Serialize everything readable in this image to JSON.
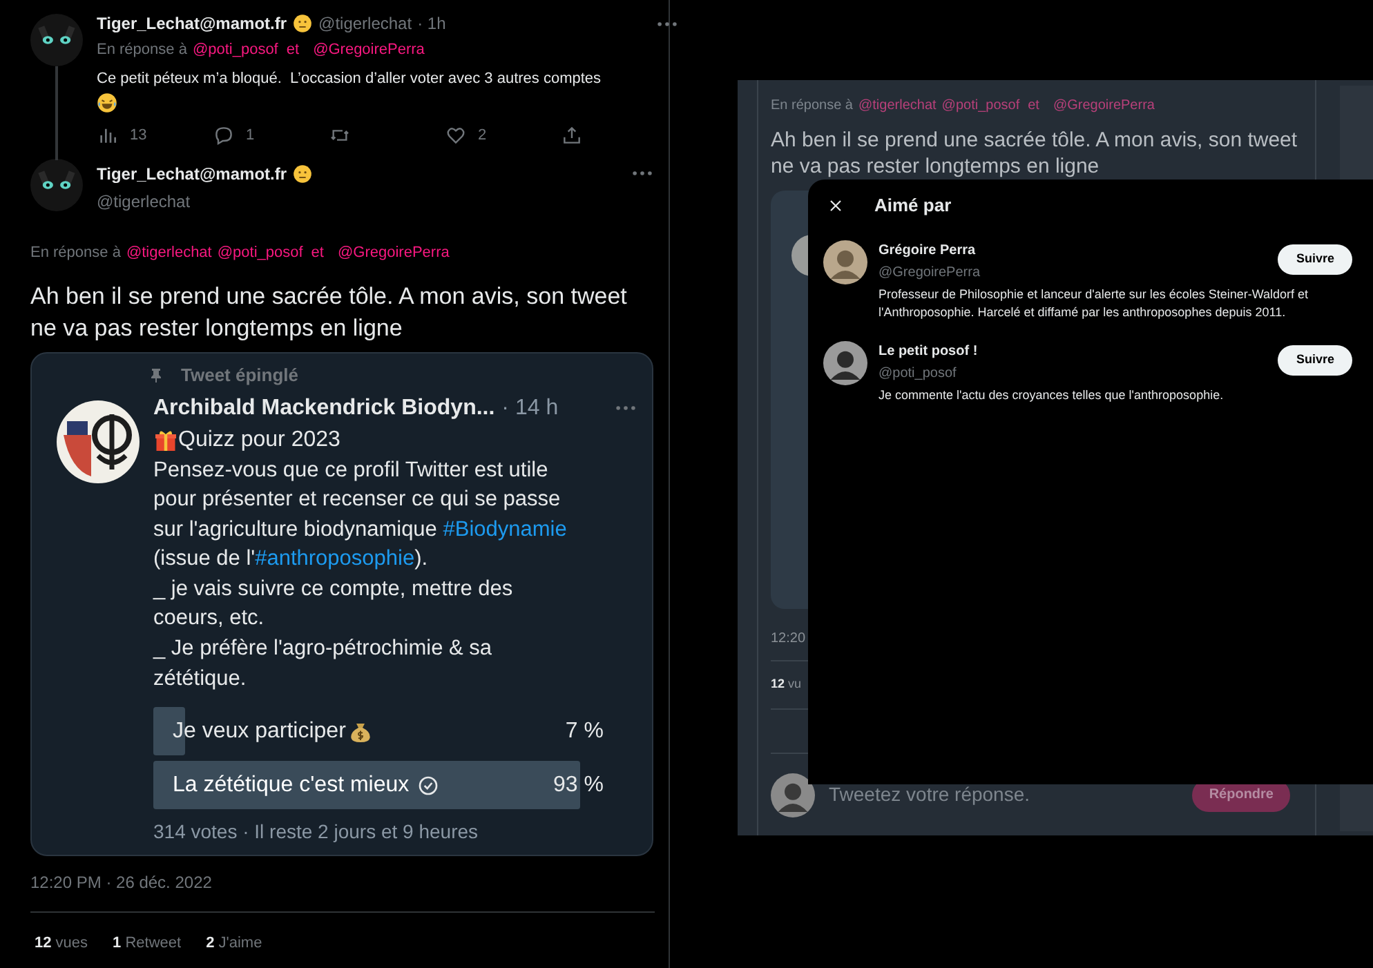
{
  "thread": [
    {
      "author": "Tiger_Lechat@mamot.fr",
      "handle": "@tigerlechat",
      "time": "· 1h",
      "reply_prefix": "En réponse à",
      "mentions": [
        {
          "text": "@poti_posof",
          "kind": "mention"
        },
        {
          "text": "et",
          "kind": "joiner"
        },
        {
          "text": "@GregoirePerra",
          "kind": "mention"
        }
      ],
      "text": "Ce petit péteux m’a bloqué.  L’occasion d’aller voter avec 3 autres comptes",
      "stats": [
        {
          "kind": "views",
          "value": "13"
        },
        {
          "kind": "reply",
          "value": "1"
        },
        {
          "kind": "retweet"
        },
        {
          "kind": "like",
          "value": "2"
        },
        {
          "kind": "share"
        }
      ]
    },
    {
      "author": "Tiger_Lechat@mamot.fr",
      "handle": "@tigerlechat",
      "reply_prefix": "En réponse à",
      "mentions": [
        {
          "text": "@tigerlechat",
          "kind": "mention"
        },
        {
          "text": "@poti_posof",
          "kind": "mention"
        },
        {
          "text": "et",
          "kind": "joiner"
        },
        {
          "text": "@GregoirePerra",
          "kind": "mention"
        }
      ],
      "text": "Ah ben il se prend une sacrée tôle. A mon avis, son tweet ne va pas rester longtemps en ligne",
      "quoted": {
        "pinned_label": "Tweet épinglé",
        "author": "Archibald Mackendrick Biodyn...",
        "time": "· 14 h",
        "title": "Quizz pour 2023",
        "body": [
          {
            "kind": "text",
            "text": "Pensez-vous que ce profil Twitter est utile\npour présenter et recenser ce qui se passe\nsur l'agriculture biodynamique "
          },
          {
            "kind": "hashtag",
            "text": "#Biodynamie"
          },
          {
            "kind": "text",
            "text": "\n(issue de l'"
          },
          {
            "kind": "hashtag",
            "text": "#anthroposophie"
          },
          {
            "kind": "text",
            "text": ").\n_ je vais suivre ce compte, mettre des\ncoeurs, etc.\n_ Je préfère l'agro-pétrochimie & sa\nzététique."
          }
        ],
        "poll": [
          {
            "label": "Je veux participer",
            "percent": "7 %",
            "selected": false
          },
          {
            "label": "La zététique c'est mieux",
            "percent": "93 %",
            "selected": true
          }
        ],
        "poll_footer": "314 votes · Il reste 2 jours et 9 heures"
      },
      "timestamp": "12:20 PM · 26 déc. 2022",
      "counts": [
        "**12** vues",
        "**1** Retweet",
        "**2** J'aime"
      ]
    }
  ],
  "dimmed_view": {
    "reply_prefix": "En réponse à",
    "mentions": [
      {
        "text": "@tigerlechat",
        "kind": "mention"
      },
      {
        "text": "@poti_posof",
        "kind": "mention"
      },
      {
        "text": "et",
        "kind": "joiner"
      },
      {
        "text": "@GregoirePerra",
        "kind": "mention"
      }
    ],
    "text": "Ah ben il se prend une sacrée tôle. A mon avis, son tweet ne va pas rester longtemps en ligne",
    "timestamp": "12:20",
    "views_value": "12",
    "views_label": "vu",
    "reply_placeholder": "Tweetez votre réponse.",
    "reply_button": {
      "label": "Répondre",
      "disabled": true
    }
  },
  "likes_dialog": {
    "title": "Aimé par",
    "users": [
      {
        "name": "Grégoire Perra",
        "handle": "@GregoirePerra",
        "bio": "Professeur de Philosophie et lanceur d'alerte sur les écoles Steiner-Waldorf et l'Anthroposophie. Harcelé et diffamé par les anthroposophes depuis 2011.",
        "button": "Suivre"
      },
      {
        "name": "Le petit posof !",
        "handle": "@poti_posof",
        "bio": "Je commente l'actu des croyances telles que l'anthroposophie.",
        "button": "Suivre"
      }
    ]
  }
}
